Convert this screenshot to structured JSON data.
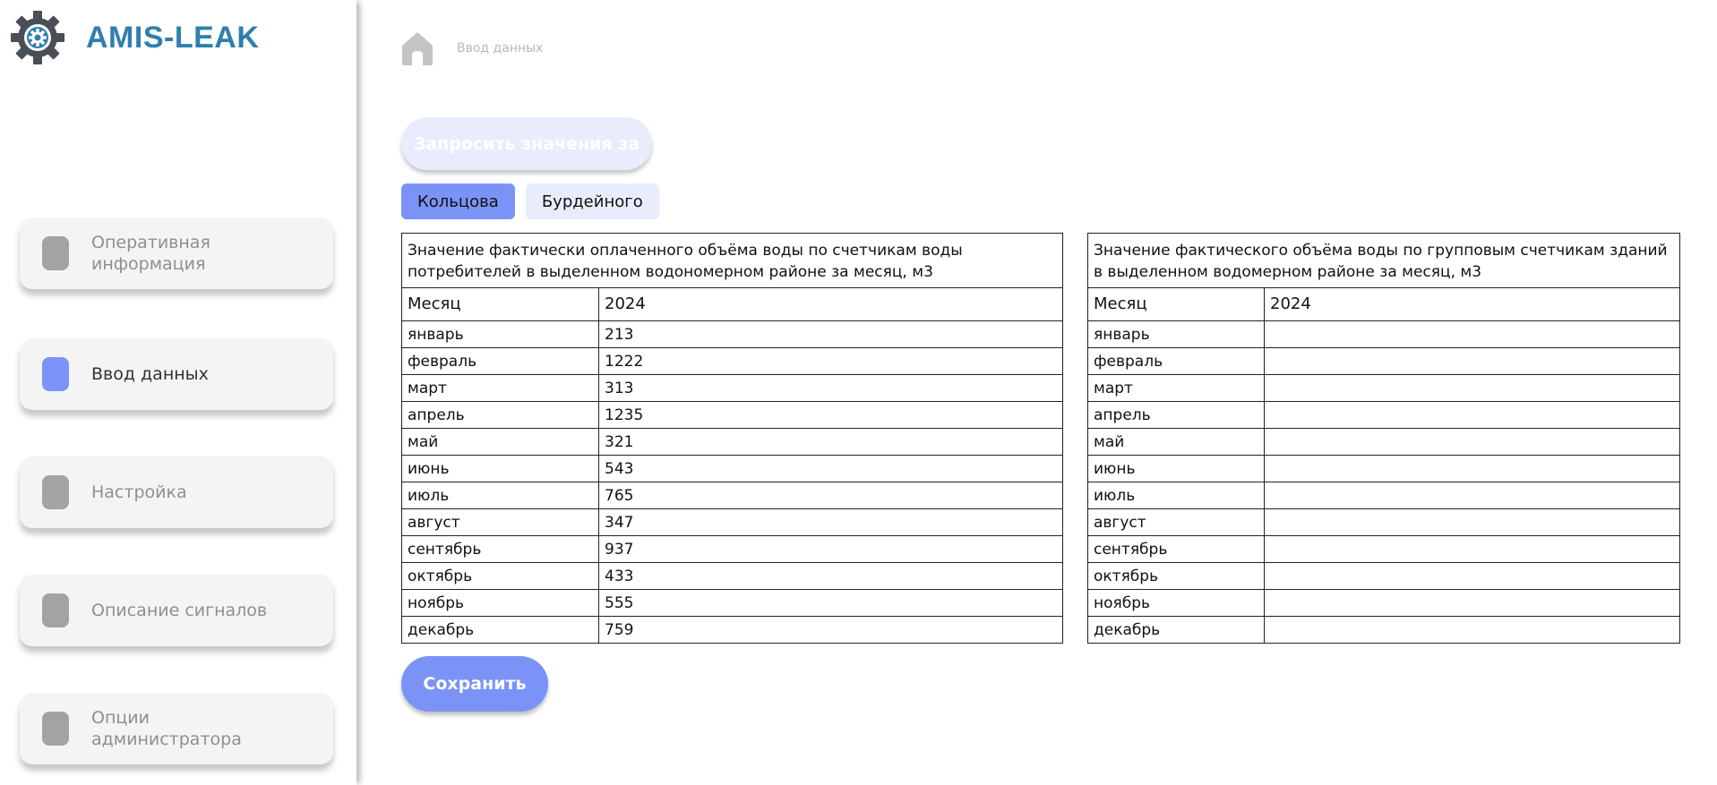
{
  "app": {
    "logo_text": "AMIS-LEAK",
    "logo_icon": "gear-icon",
    "accent_color": "#7b93f7",
    "brand_color": "#2f7fae"
  },
  "sidebar": {
    "items": [
      {
        "label": "Оперативная информация",
        "active": false
      },
      {
        "label": "Ввод данных",
        "active": true
      },
      {
        "label": "Настройка",
        "active": false
      },
      {
        "label": "Описание сигналов",
        "active": false
      },
      {
        "label": "Опции администратора",
        "active": false
      }
    ]
  },
  "breadcrumb": {
    "icon": "home-icon",
    "text": "Ввод данных"
  },
  "actions": {
    "query_label": "Запросить значения за",
    "save_label": "Сохранить"
  },
  "tabs": [
    {
      "label": "Кольцова",
      "active": true
    },
    {
      "label": "Бурдейного",
      "active": false
    }
  ],
  "tables": {
    "left": {
      "title": "Значение фактически оплаченного объёма воды по счетчикам воды потребителей в выделенном водономерном районе за месяц, м3",
      "col_month": "Месяц",
      "col_year": "2024",
      "rows": [
        {
          "month": "январь",
          "value": "213"
        },
        {
          "month": "февраль",
          "value": "1222"
        },
        {
          "month": "март",
          "value": "313"
        },
        {
          "month": "апрель",
          "value": "1235"
        },
        {
          "month": "май",
          "value": "321"
        },
        {
          "month": "июнь",
          "value": "543"
        },
        {
          "month": "июль",
          "value": "765"
        },
        {
          "month": "август",
          "value": "347"
        },
        {
          "month": "сентябрь",
          "value": "937"
        },
        {
          "month": "октябрь",
          "value": "433"
        },
        {
          "month": "ноябрь",
          "value": "555"
        },
        {
          "month": "декабрь",
          "value": "759"
        }
      ]
    },
    "right": {
      "title": "Значение фактического объёма воды по групповым счетчикам зданий в выделенном водомерном районе за месяц, м3",
      "col_month": "Месяц",
      "col_year": "2024",
      "rows": [
        {
          "month": "январь",
          "value": ""
        },
        {
          "month": "февраль",
          "value": ""
        },
        {
          "month": "март",
          "value": ""
        },
        {
          "month": "апрель",
          "value": ""
        },
        {
          "month": "май",
          "value": ""
        },
        {
          "month": "июнь",
          "value": ""
        },
        {
          "month": "июль",
          "value": ""
        },
        {
          "month": "август",
          "value": ""
        },
        {
          "month": "сентябрь",
          "value": ""
        },
        {
          "month": "октябрь",
          "value": ""
        },
        {
          "month": "ноябрь",
          "value": ""
        },
        {
          "month": "декабрь",
          "value": ""
        }
      ]
    }
  }
}
